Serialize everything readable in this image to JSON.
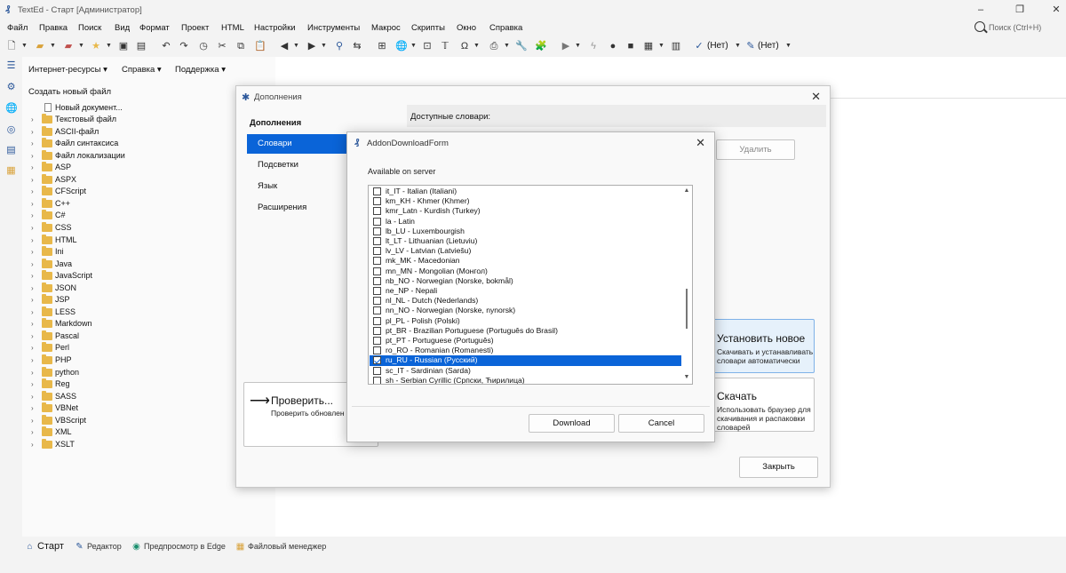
{
  "window": {
    "title": "TextEd - Старт [Администратор]"
  },
  "menu": [
    "Файл",
    "Правка",
    "Поиск",
    "Вид",
    "Формат",
    "Проект",
    "HTML",
    "Настройки",
    "Инструменты",
    "Макрос",
    "Скрипты",
    "Окно",
    "Справка"
  ],
  "search": {
    "placeholder": "Поиск (Ctrl+H)"
  },
  "toolbar": {
    "lang1": "(Нет)",
    "lang2": "(Нет)"
  },
  "panel": {
    "menus": [
      "Интернет-ресурсы",
      "Справка",
      "Поддержка"
    ],
    "create_label": "Создать новый файл",
    "new_doc": "Новый документ...",
    "items": [
      "Текстовый файл",
      "ASCII-файл",
      "Файл синтаксиса",
      "Файл локализации",
      "ASP",
      "ASPX",
      "CFScript",
      "C++",
      "C#",
      "CSS",
      "HTML",
      "Ini",
      "Java",
      "JavaScript",
      "JSON",
      "JSP",
      "LESS",
      "Markdown",
      "Pascal",
      "Perl",
      "PHP",
      "python",
      "Reg",
      "SASS",
      "VBNet",
      "VBScript",
      "XML",
      "XSLT"
    ]
  },
  "bottom_tabs": [
    "Старт",
    "Редактор",
    "Предпросмотр в Edge",
    "Файловый менеджер"
  ],
  "addons": {
    "title": "Дополнения",
    "nav_head": "Дополнения",
    "nav": [
      "Словари",
      "Подсветки",
      "Язык",
      "Расширения"
    ],
    "available_head": "Доступные словари:",
    "delete_label": "Удалить",
    "install_title": "Установить новое",
    "install_desc": [
      "Скачивать и устанавливать",
      "словари автоматически"
    ],
    "download_title": "Скачать",
    "download_desc": [
      "Использовать браузер для",
      "скачивания и распаковки",
      "словарей"
    ],
    "check_title": "Проверить...",
    "check_desc": "Проверить обновлен",
    "close_label": "Закрыть"
  },
  "download_form": {
    "title": "AddonDownloadForm",
    "available_label": "Available on server",
    "items": [
      {
        "label": "it_IT - Italian (Italiani)",
        "checked": false
      },
      {
        "label": "km_KH - Khmer (Khmer)",
        "checked": false
      },
      {
        "label": "kmr_Latn - Kurdish (Turkey)",
        "checked": false
      },
      {
        "label": "la - Latin",
        "checked": false
      },
      {
        "label": "lb_LU - Luxembourgish",
        "checked": false
      },
      {
        "label": "lt_LT - Lithuanian (Lietuviu)",
        "checked": false
      },
      {
        "label": "lv_LV - Latvian (Latviešu)",
        "checked": false
      },
      {
        "label": "mk_MK - Macedonian",
        "checked": false
      },
      {
        "label": "mn_MN - Mongolian (Монгол)",
        "checked": false
      },
      {
        "label": "nb_NO - Norwegian (Norske, bokmål)",
        "checked": false
      },
      {
        "label": "ne_NP - Nepali",
        "checked": false
      },
      {
        "label": "nl_NL - Dutch (Nederlands)",
        "checked": false
      },
      {
        "label": "nn_NO - Norwegian (Norske, nynorsk)",
        "checked": false
      },
      {
        "label": "pl_PL - Polish (Polski)",
        "checked": false
      },
      {
        "label": "pt_BR - Brazilian Portuguese (Português do Brasil)",
        "checked": false
      },
      {
        "label": "pt_PT - Portuguese (Português)",
        "checked": false
      },
      {
        "label": "ro_RO - Romanian (Romanesti)",
        "checked": false
      },
      {
        "label": "ru_RU - Russian (Русский)",
        "checked": true,
        "selected": true
      },
      {
        "label": "sc_IT - Sardinian (Sarda)",
        "checked": false
      },
      {
        "label": "sh - Serbian Cyrillic (Српски, Ћирилица)",
        "checked": false
      }
    ],
    "download_label": "Download",
    "cancel_label": "Cancel"
  },
  "colors": {
    "accent": "#0a64d8",
    "brand": "#2b579a",
    "folder": "#e8b84a"
  }
}
